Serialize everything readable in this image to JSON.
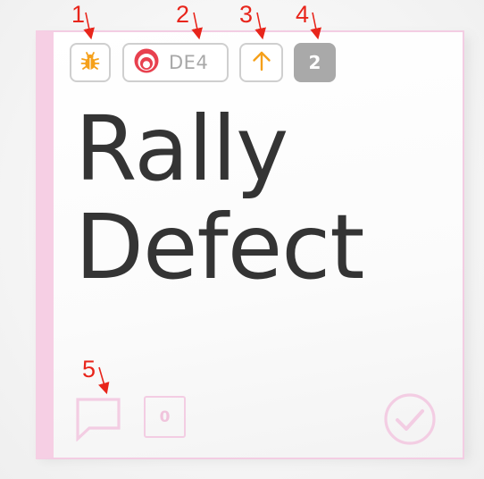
{
  "card": {
    "type_icon": "bug-icon",
    "id_icon": "defect-target-icon",
    "id_label": "DE4",
    "priority_icon": "arrow-up-icon",
    "estimate_label": "2",
    "title_lines": [
      "Rally",
      "Defect"
    ],
    "comment_icon": "comment-icon",
    "comment_count": "0",
    "done_icon": "check-circle-icon"
  },
  "annotations": [
    "1",
    "2",
    "3",
    "4",
    "5"
  ],
  "colors": {
    "card_accent": "#f6cfe4",
    "title_text": "#343434",
    "chip_border": "#cfcfcf",
    "estimate_bg": "#a9a9a9",
    "priority_icon": "#f5a01a",
    "defect_icon": "#e8414f",
    "annotation": "#e8251b"
  }
}
